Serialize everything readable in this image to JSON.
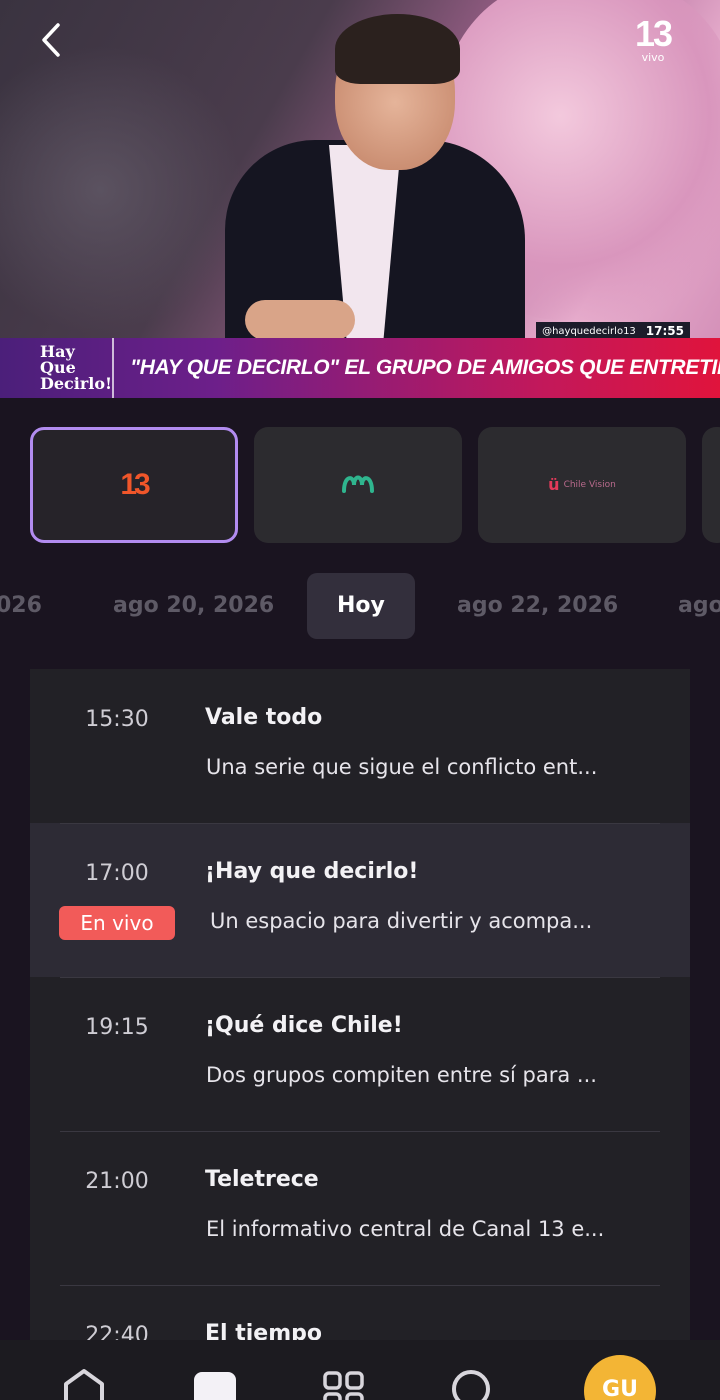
{
  "video": {
    "channel_number": "13",
    "channel_live_label": "vivo",
    "lower_third_brand": [
      "Hay Que",
      "Decirlo!"
    ],
    "lower_third_text": "\"HAY QUE DECIRLO\" EL GRUPO DE AMIGOS QUE ENTRETIENE TU TARDE",
    "social_handle": "@hayquedecirlo13",
    "clock": "17:55"
  },
  "channels": [
    {
      "label": "13",
      "icon": "canal-13-logo",
      "selected": true
    },
    {
      "label": "",
      "icon": "mega-logo",
      "selected": false
    },
    {
      "label": "Chile Vision",
      "icon": "chilevision-logo",
      "selected": false
    }
  ],
  "dates": {
    "prev_partial": "026",
    "prev": "ago 20, 2026",
    "today": "Hoy",
    "next": "ago 22, 2026",
    "next_partial": "ago"
  },
  "schedule": [
    {
      "time": "15:30",
      "title": "Vale todo",
      "desc": "Una serie que sigue el conflicto ent...",
      "live": false
    },
    {
      "time": "17:00",
      "title": "¡Hay que decirlo!",
      "desc": "Un espacio para divertir y acompa...",
      "live": true,
      "badge": "En vivo"
    },
    {
      "time": "19:15",
      "title": "¡Qué dice Chile!",
      "desc": "Dos grupos compiten entre sí para ...",
      "live": false
    },
    {
      "time": "21:00",
      "title": "Teletrece",
      "desc": "El informativo central de Canal 13 e...",
      "live": false
    },
    {
      "time": "22:40",
      "title": "El tiempo",
      "desc": "",
      "live": false
    }
  ],
  "nav": {
    "items": [
      "home-icon",
      "live-tv-icon",
      "categories-icon",
      "search-icon"
    ],
    "avatar_initials": "GU"
  },
  "colors": {
    "accent": "#b28cf0",
    "live_badge": "#f25b59",
    "avatar": "#f3b535"
  }
}
